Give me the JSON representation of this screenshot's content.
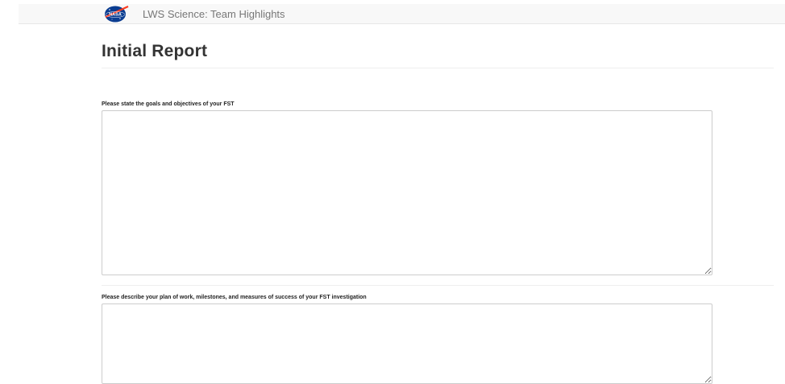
{
  "navbar": {
    "logo_icon": "nasa-logo-icon",
    "brand_text": "LWS Science: Team Highlights"
  },
  "page": {
    "title": "Initial Report"
  },
  "fields": [
    {
      "label": "Please state the goals and objectives of your FST",
      "value": ""
    },
    {
      "label": "Please describe your plan of work, milestones, and measures of success of your FST investigation",
      "value": ""
    }
  ],
  "colors": {
    "navbar_bg": "#f8f8f8",
    "nasa_blue": "#0b3d91",
    "nasa_red": "#fc3d21",
    "border": "#cccccc"
  }
}
